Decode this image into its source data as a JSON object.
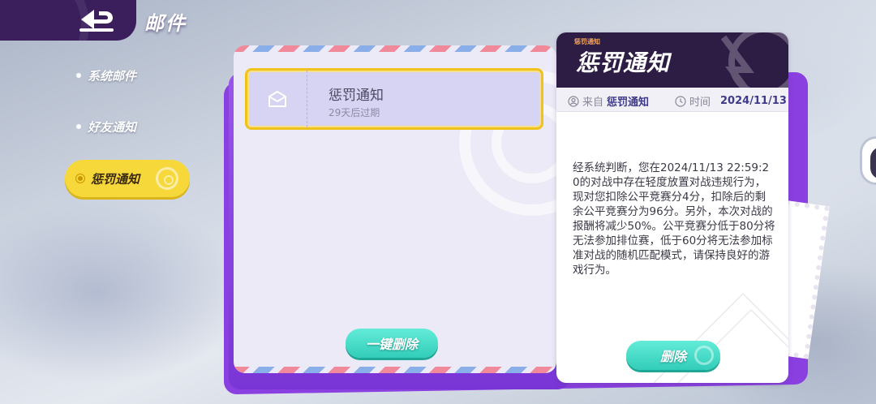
{
  "header": {
    "back_icon": "return-arrow-icon",
    "title": "邮件"
  },
  "sidebar": {
    "items": [
      {
        "label": "系统邮件",
        "active": false
      },
      {
        "label": "好友通知",
        "active": false
      },
      {
        "label": "惩罚通知",
        "active": true
      }
    ]
  },
  "mail_list": {
    "items": [
      {
        "title": "惩罚通知",
        "expiry": "29天后过期",
        "icon": "envelope-icon",
        "selected": true
      }
    ],
    "delete_all_label": "一键删除"
  },
  "detail": {
    "tag": "惩罚通知",
    "title": "惩罚通知",
    "from_label": "来自",
    "from_value": "惩罚通知",
    "time_label": "时间",
    "time_value": "2024/11/13",
    "body": "经系统判断，您在2024/11/13 22:59:20的对战中存在轻度放置对战违规行为，现对您扣除公平竞赛分4分，扣除后的剩余公平竞赛分为96分。另外，本次对战的报酬将减少50%。公平竞赛分低于80分将无法参加排位赛，低于60分将无法参加标准对战的随机匹配模式，请保持良好的游戏行为。",
    "delete_label": "删除"
  },
  "colors": {
    "accent_yellow": "#f7d83b",
    "header_purple": "#2d1c44",
    "teal_button": "#32cdb9",
    "envelope_purple": "#8a3fe0"
  }
}
